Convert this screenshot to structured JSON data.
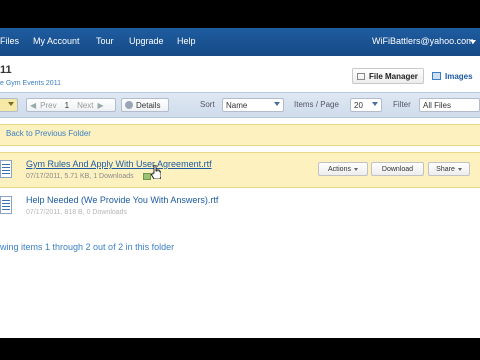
{
  "nav": {
    "files": "Files",
    "my_account": "My Account",
    "tour": "Tour",
    "upgrade": "Upgrade",
    "help": "Help",
    "user_email": "WiFiBattlers@yahoo.com"
  },
  "header": {
    "folder_title": "11",
    "breadcrumb": "e Gym Events 2011",
    "file_manager": "File Manager",
    "images": "Images"
  },
  "toolbar": {
    "prev": "Prev",
    "page": "1",
    "next": "Next",
    "details": "Details",
    "sort_label": "Sort",
    "sort_value": "Name",
    "items_label": "Items / Page",
    "items_value": "20",
    "filter_label": "Filter",
    "filter_value": "All Files"
  },
  "back_link": "Back to Previous Folder",
  "files": [
    {
      "name": "Gym Rules And Apply With User Agreement.rtf",
      "meta": "07/17/2011, 5.71 KB, 1 Downloads",
      "actions": "Actions",
      "download": "Download",
      "share": "Share"
    },
    {
      "name": "Help Needed (We Provide You With Answers).rtf",
      "meta": "07/17/2011, 818 B, 0 Downloads"
    }
  ],
  "status": "wing items 1 through 2 out of 2 in this folder",
  "colors": {
    "nav_bg": "#1e5ca0",
    "link": "#1d5aa3",
    "highlight_row": "#fdf1bf",
    "toolbar_bg": "#dfe8f3"
  }
}
